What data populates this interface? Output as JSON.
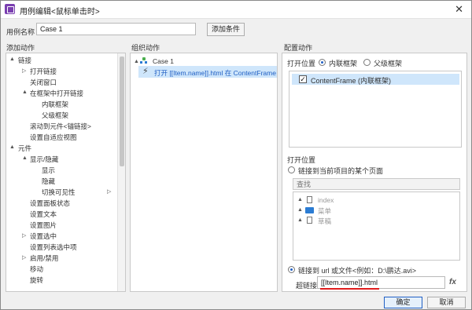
{
  "window": {
    "title": "用例编辑<鼠标单击时>"
  },
  "header": {
    "case_name_label": "用例名称",
    "case_name_value": "Case 1",
    "add_condition": "添加条件"
  },
  "columns": {
    "add_action": "添加动作",
    "organize_action": "组织动作",
    "configure_action": "配置动作"
  },
  "actions_tree": [
    {
      "label": "链接",
      "expand": "▲"
    },
    {
      "label": "打开链接",
      "expand": "▷"
    },
    {
      "label": "关闭窗口",
      "expand": ""
    },
    {
      "label": "在框架中打开链接",
      "expand": "▲"
    },
    {
      "label": "内联框架",
      "expand": ""
    },
    {
      "label": "父级框架",
      "expand": ""
    },
    {
      "label": "滚动到元件<锚链接>",
      "expand": ""
    },
    {
      "label": "设置自适应视图",
      "expand": ""
    },
    {
      "label": "元件",
      "expand": "▲"
    },
    {
      "label": "显示/隐藏",
      "expand": "▲"
    },
    {
      "label": "显示",
      "expand": ""
    },
    {
      "label": "隐藏",
      "expand": ""
    },
    {
      "label": "切换可见性",
      "expand": "",
      "right": "▷"
    },
    {
      "label": "设置面板状态",
      "expand": ""
    },
    {
      "label": "设置文本",
      "expand": ""
    },
    {
      "label": "设置图片",
      "expand": ""
    },
    {
      "label": "设置选中",
      "expand": "▷"
    },
    {
      "label": "设置列表选中项",
      "expand": ""
    },
    {
      "label": "启用/禁用",
      "expand": "▷"
    },
    {
      "label": "移动",
      "expand": ""
    },
    {
      "label": "旋转",
      "expand": ""
    }
  ],
  "organize": {
    "case_label": "Case 1",
    "action_label": "打开 [[Item.name]].html 在 ContentFrame"
  },
  "configure": {
    "open_in_label": "打开位置",
    "radio_inline": "内联框架",
    "radio_parent": "父级框架",
    "frame_item": "ContentFrame (内联框架)",
    "open_in_label2": "打开位置",
    "radio_page": "链接到当前项目的某个页面",
    "search_placeholder": "查找",
    "pages": [
      {
        "label": "index",
        "kind": "file"
      },
      {
        "label": "菜单",
        "kind": "folder"
      },
      {
        "label": "草稿",
        "kind": "file"
      }
    ],
    "radio_url": "链接到 url 或文件<例如：D:\\鹏达.avi>",
    "hyperlink_label": "超链接",
    "hyperlink_value": "[[Item.name]].html",
    "fx_label": "fx"
  },
  "footer": {
    "ok": "确定",
    "cancel": "取消"
  },
  "colors": {
    "accent": "#2160c4",
    "selection": "#cfe6fb",
    "underline": "#e01d1d"
  }
}
